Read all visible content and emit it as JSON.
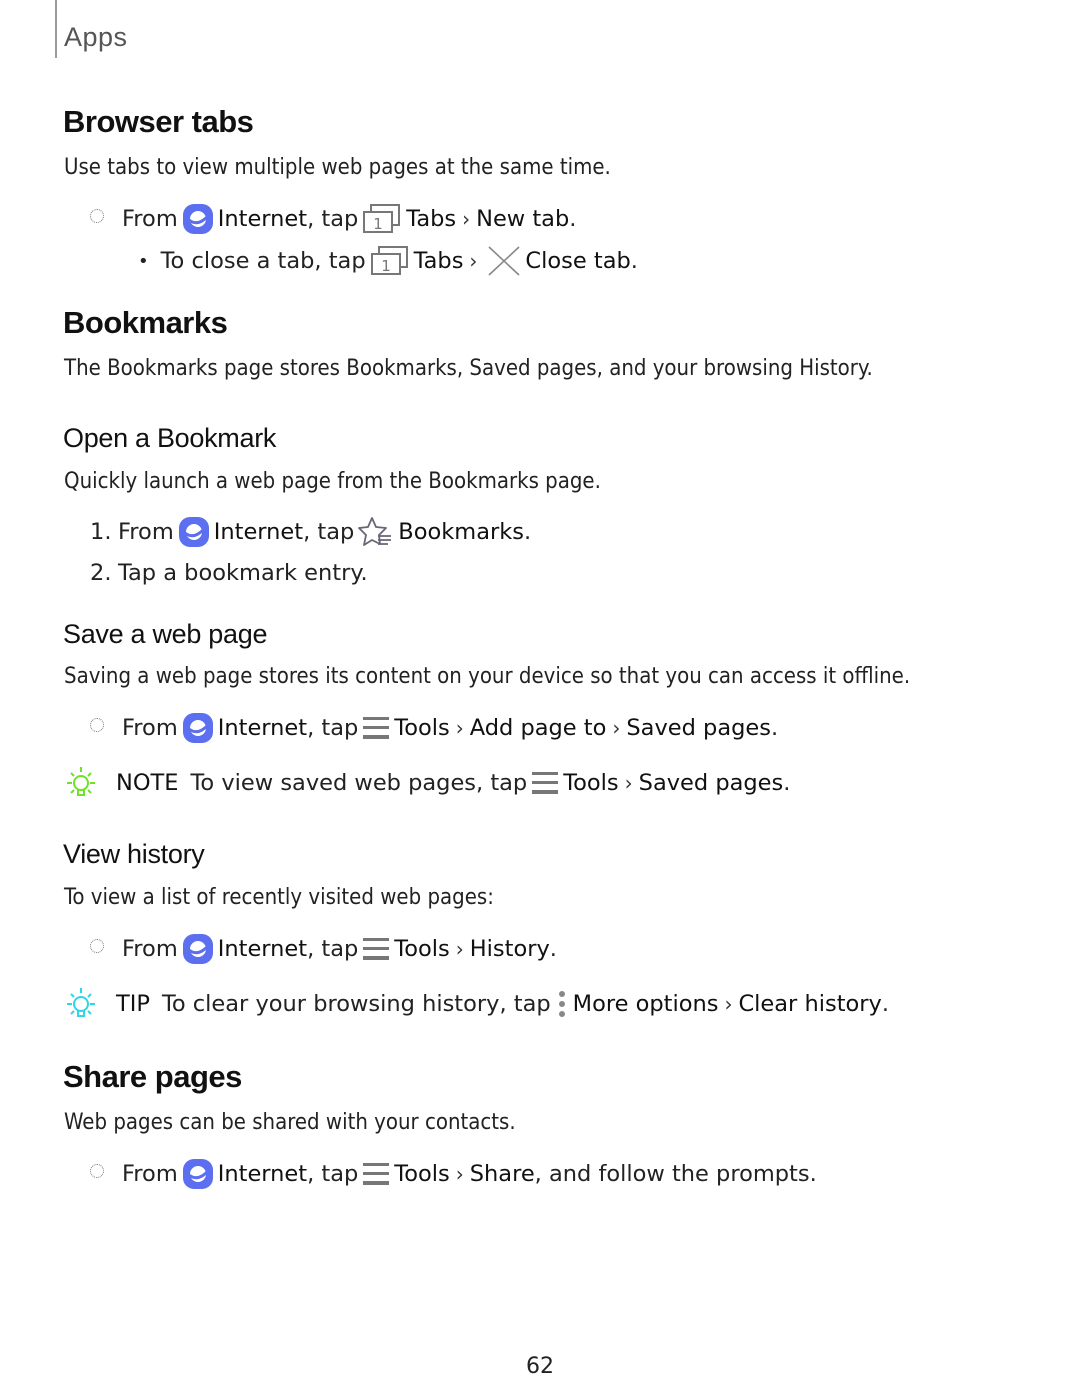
{
  "header": {
    "section": "Apps"
  },
  "sections": {
    "browser_tabs": {
      "title": "Browser tabs",
      "intro": "Use tabs to view multiple web pages at the same time.",
      "step": {
        "from": "From",
        "app": "Internet",
        "tap": ", tap",
        "tabs": "Tabs",
        "action": "New tab",
        "end": "."
      },
      "sub": {
        "text": "To close a tab, tap",
        "tabs": "Tabs",
        "action": "Close tab",
        "end": "."
      }
    },
    "bookmarks": {
      "title": "Bookmarks",
      "intro": "The Bookmarks page stores Bookmarks, Saved pages, and your browsing History."
    },
    "open_bookmark": {
      "title": "Open a Bookmark",
      "intro": "Quickly launch a web page from the Bookmarks page.",
      "steps": [
        {
          "num": "1.",
          "from": "From",
          "app": "Internet",
          "tap": ", tap",
          "target": "Bookmarks",
          "end": "."
        },
        {
          "num": "2.",
          "text": "Tap a bookmark entry."
        }
      ]
    },
    "save_page": {
      "title": "Save a web page",
      "intro": "Saving a web page stores its content on your device so that you can access it offline.",
      "step": {
        "from": "From",
        "app": "Internet",
        "tap": ", tap",
        "tools": "Tools",
        "path1": "Add page to",
        "path2": "Saved pages",
        "end": "."
      },
      "note": {
        "label": "NOTE",
        "text": "To view saved web pages, tap",
        "tools": "Tools",
        "path": "Saved pages",
        "end": "."
      }
    },
    "view_history": {
      "title": "View history",
      "intro": "To view a list of recently visited web pages:",
      "step": {
        "from": "From",
        "app": "Internet",
        "tap": ", tap",
        "tools": "Tools",
        "path": "History",
        "end": "."
      },
      "tip": {
        "label": "TIP",
        "text": "To clear your browsing history, tap",
        "more": "More options",
        "path": "Clear history",
        "end": "."
      }
    },
    "share_pages": {
      "title": "Share pages",
      "intro": "Web pages can be shared with your contacts.",
      "step": {
        "from": "From",
        "app": "Internet",
        "tap": ", tap",
        "tools": "Tools",
        "path": "Share",
        "rest": ", and follow the prompts."
      }
    }
  },
  "icons": {
    "internet": "samsung-internet-icon",
    "tabs": "tabs-icon",
    "close": "close-x-icon",
    "bookmarks": "bookmark-star-icon",
    "tools": "tools-menu-icon",
    "more": "more-options-icon",
    "note": "lightbulb-icon",
    "tabs_count": "1"
  },
  "colors": {
    "internet_icon": "#5b6ff0",
    "note_bulb": "#6fe12a",
    "tip_bulb": "#2fd6e8",
    "icon_gray": "#7a7a7a"
  },
  "footer": {
    "page_number": "62"
  }
}
